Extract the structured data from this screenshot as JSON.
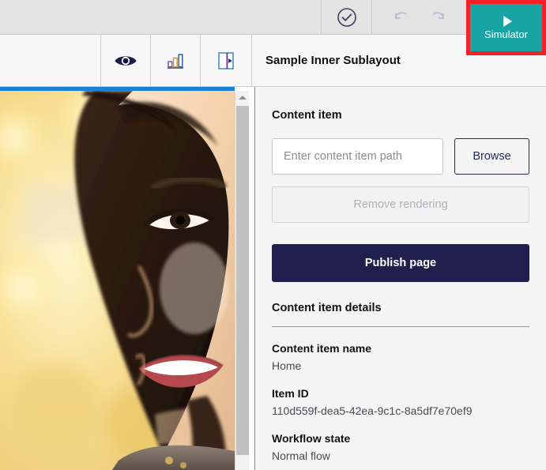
{
  "topbar": {
    "approve_icon": "circle-check-icon",
    "undo_icon": "undo-icon",
    "redo_icon": "redo-icon",
    "simulator": {
      "label": "Simulator",
      "icon": "play-icon",
      "background": "#18a4a2",
      "highlight_border": "#f71f28"
    }
  },
  "subbar": {
    "icons": [
      {
        "name": "eye-icon",
        "title": "Preview"
      },
      {
        "name": "bar-chart-icon",
        "title": "Analytics"
      },
      {
        "name": "panel-toggle-icon",
        "title": "Toggle panel"
      }
    ],
    "title": "Sample Inner Sublayout"
  },
  "stage": {
    "accent_color": "#1b7fd4",
    "image_alt": "smiling-woman-photo",
    "scrollbar": {
      "up_arrow": "caret-up-icon"
    }
  },
  "panel": {
    "content_item_heading": "Content item",
    "path_placeholder": "Enter content item path",
    "path_value": "",
    "browse_label": "Browse",
    "remove_label": "Remove rendering",
    "publish_label": "Publish page",
    "publish_color": "#20204f",
    "details_heading": "Content item details",
    "details": [
      {
        "label": "Content item name",
        "value": "Home"
      },
      {
        "label": "Item ID",
        "value": "110d559f-dea5-42ea-9c1c-8a5df7e70ef9"
      },
      {
        "label": "Workflow state",
        "value": "Normal flow"
      }
    ]
  }
}
